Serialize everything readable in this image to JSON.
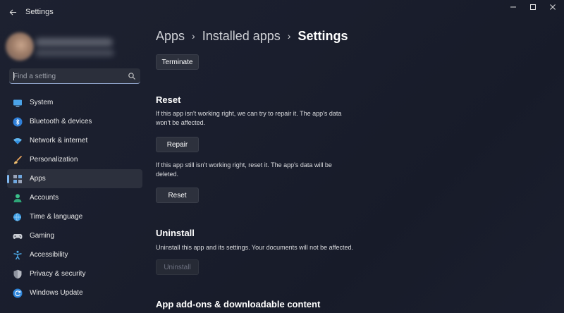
{
  "window": {
    "title": "Settings"
  },
  "sidebar": {
    "search": {
      "placeholder": "Find a setting",
      "value": ""
    },
    "items": [
      {
        "label": "System",
        "icon": "monitor-icon"
      },
      {
        "label": "Bluetooth & devices",
        "icon": "bluetooth-icon"
      },
      {
        "label": "Network & internet",
        "icon": "wifi-icon"
      },
      {
        "label": "Personalization",
        "icon": "brush-icon"
      },
      {
        "label": "Apps",
        "icon": "apps-icon",
        "selected": true
      },
      {
        "label": "Accounts",
        "icon": "person-icon"
      },
      {
        "label": "Time & language",
        "icon": "globe-clock-icon"
      },
      {
        "label": "Gaming",
        "icon": "gamepad-icon"
      },
      {
        "label": "Accessibility",
        "icon": "accessibility-icon"
      },
      {
        "label": "Privacy & security",
        "icon": "shield-icon"
      },
      {
        "label": "Windows Update",
        "icon": "update-icon"
      }
    ]
  },
  "breadcrumb": [
    "Apps",
    "Installed apps",
    "Settings"
  ],
  "main": {
    "terminate_label": "Terminate",
    "reset_section": {
      "title": "Reset",
      "repair_desc_1": "If this app isn't working right, we can try to repair it. The app's data",
      "repair_desc_2": "won't be affected.",
      "repair_label": "Repair",
      "reset_desc_1": "If this app still isn't working right, reset it. The app's data will be",
      "reset_desc_2": "deleted.",
      "reset_label": "Reset"
    },
    "uninstall_section": {
      "title": "Uninstall",
      "desc": "Uninstall this app and its settings. Your documents will not be affected.",
      "uninstall_label": "Uninstall"
    },
    "addons_title": "App add-ons & downloadable content"
  },
  "colors": {
    "accent": "#7fb8f0",
    "background": "#1b1f2e",
    "button": "#2d313d"
  }
}
